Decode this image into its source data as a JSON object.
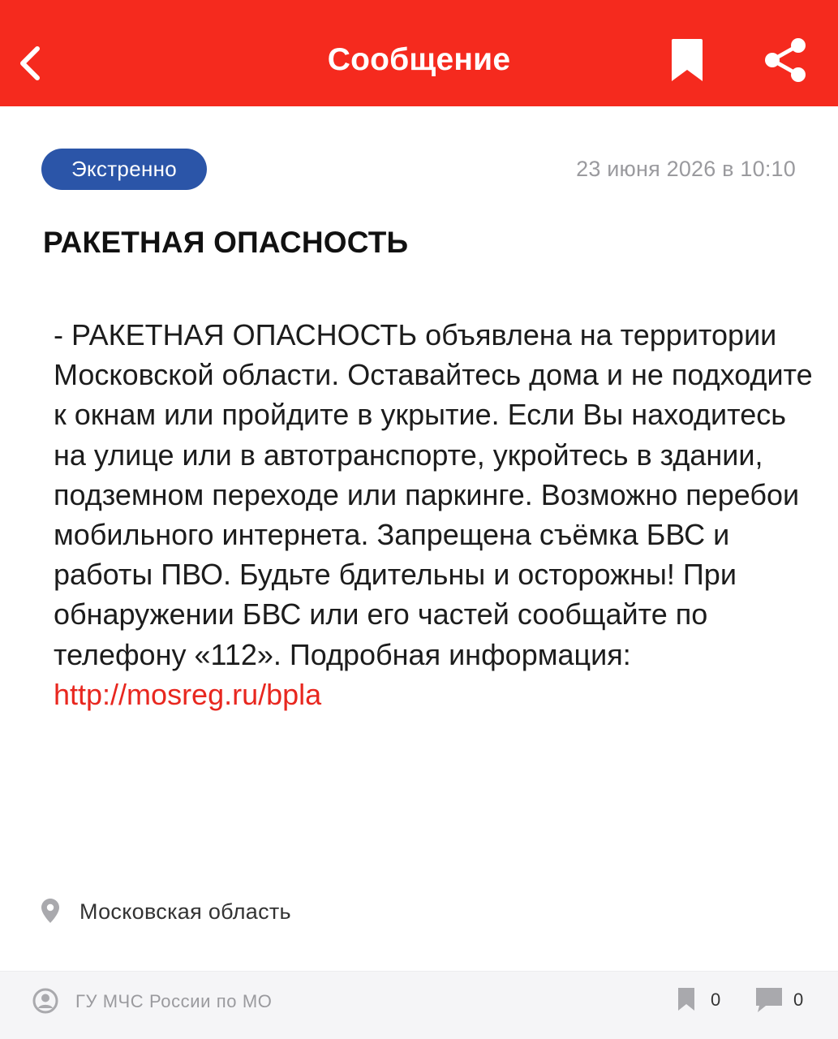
{
  "header": {
    "title": "Сообщение",
    "back_icon": "chevron-left-icon",
    "bookmark_icon": "bookmark-icon",
    "share_icon": "share-icon",
    "background_color": "#f52a1e"
  },
  "message": {
    "badge": "Экстренно",
    "badge_color": "#2b55a8",
    "date": "23 июня 2026 в 10:10",
    "title": "РАКЕТНАЯ ОПАСНОСТЬ",
    "body": "- РАКЕТНАЯ ОПАСНОСТЬ объявлена на территории Московской области. Оставайтесь дома и не подходите к окнам или пройдите в укрытие. Если Вы находитесь на улице или в автотранспорте, укройтесь в здании, подземном переходе или паркинге. Возможно перебои мобильного интернета. Запрещена съёмка БВС и работы ПВО. Будьте бдительны и осторожны! При обнаружении БВС или его частей сообщайте по телефону «112». Подробная информация:",
    "link": "http://mosreg.ru/bpla",
    "link_color": "#e8271f"
  },
  "location": {
    "icon": "location-pin-icon",
    "text": "Московская область"
  },
  "footer": {
    "source_icon": "user-circle-icon",
    "source": "ГУ МЧС России по МО",
    "bookmarks_count": "0",
    "comments_count": "0"
  }
}
